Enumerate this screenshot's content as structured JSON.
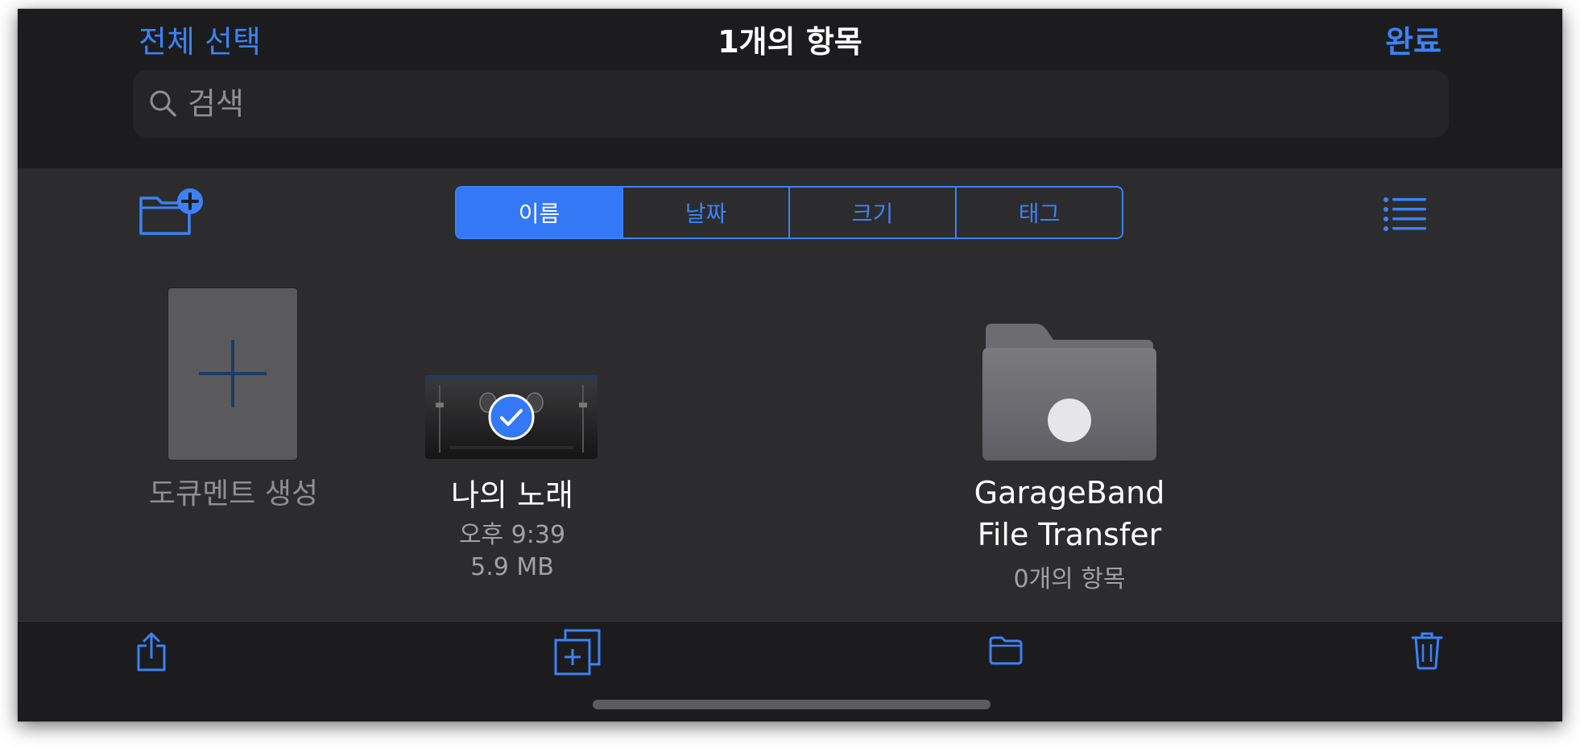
{
  "header": {
    "select_all_label": "전체 선택",
    "title": "1개의 항목",
    "done_label": "완료"
  },
  "search": {
    "placeholder": "검색"
  },
  "sort": {
    "tabs": [
      "이름",
      "날짜",
      "크기",
      "태그"
    ],
    "selected": "이름"
  },
  "items": {
    "create_doc_label": "도큐멘트 생성",
    "song": {
      "name": "나의 노래",
      "time": "오후 9:39",
      "size": "5.9 MB",
      "selected": true
    },
    "folder": {
      "name": "GarageBand File Transfer",
      "count": "0개의 항목"
    }
  },
  "toolbar": {
    "icons": [
      "share-icon",
      "duplicate-icon",
      "move-folder-icon",
      "trash-icon"
    ]
  },
  "colors": {
    "accent": "#3b82f6",
    "background": "#2c2c2e",
    "bar": "#1c1c1e"
  }
}
